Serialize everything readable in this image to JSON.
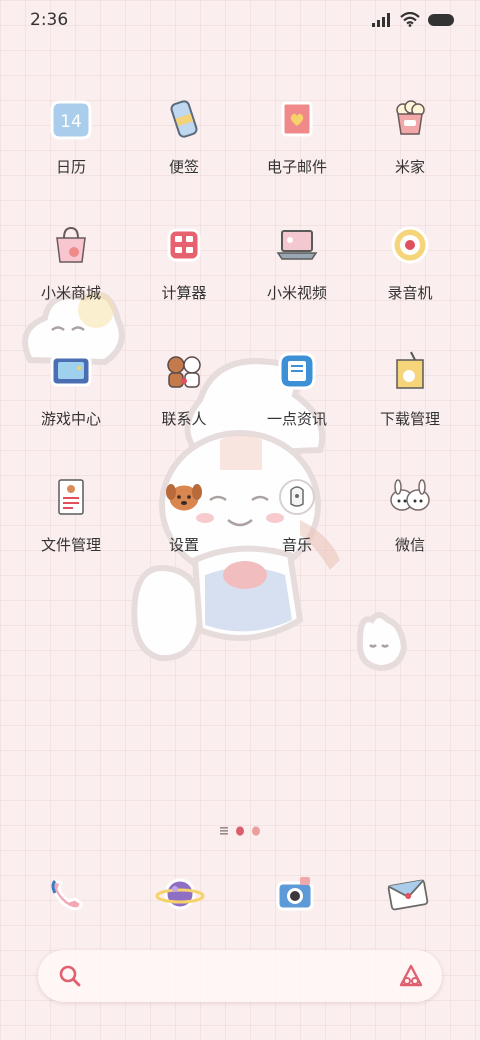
{
  "status_bar": {
    "time": "2:36",
    "icons": [
      "signal-icon",
      "wifi-icon",
      "battery-icon"
    ]
  },
  "apps": [
    {
      "label": "日历",
      "icon": "calendar-icon",
      "badge": "14"
    },
    {
      "label": "便签",
      "icon": "notes-icon"
    },
    {
      "label": "电子邮件",
      "icon": "email-icon"
    },
    {
      "label": "米家",
      "icon": "mijia-icon"
    },
    {
      "label": "小米商城",
      "icon": "mi-store-icon"
    },
    {
      "label": "计算器",
      "icon": "calculator-icon"
    },
    {
      "label": "小米视频",
      "icon": "mi-video-icon"
    },
    {
      "label": "录音机",
      "icon": "recorder-icon"
    },
    {
      "label": "游戏中心",
      "icon": "game-center-icon"
    },
    {
      "label": "联系人",
      "icon": "contacts-icon"
    },
    {
      "label": "一点资讯",
      "icon": "news-icon"
    },
    {
      "label": "下载管理",
      "icon": "download-manager-icon"
    },
    {
      "label": "文件管理",
      "icon": "file-manager-icon"
    },
    {
      "label": "设置",
      "icon": "settings-icon"
    },
    {
      "label": "音乐",
      "icon": "music-icon"
    },
    {
      "label": "微信",
      "icon": "wechat-icon"
    }
  ],
  "page_indicator": {
    "pages": 3,
    "current": 1
  },
  "dock": [
    {
      "icon": "phone-icon"
    },
    {
      "icon": "browser-planet-icon"
    },
    {
      "icon": "camera-icon"
    },
    {
      "icon": "messages-icon"
    }
  ],
  "search_bar": {
    "placeholder": "",
    "icons": [
      "search-icon",
      "assistant-icon"
    ]
  },
  "colors": {
    "background": "#fbeeee",
    "accent": "#e06070",
    "label": "#333333"
  }
}
